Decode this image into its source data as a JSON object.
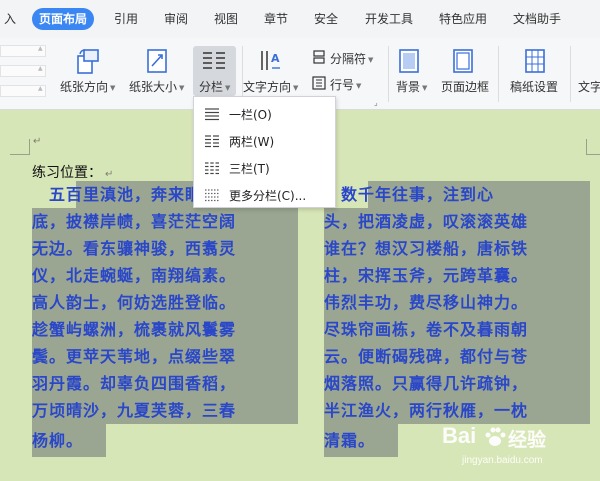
{
  "menubar": {
    "items": [
      {
        "label": "插入",
        "active": false
      },
      {
        "label": "页面布局",
        "active": true
      },
      {
        "label": "引用",
        "active": false
      },
      {
        "label": "审阅",
        "active": false
      },
      {
        "label": "视图",
        "active": false
      },
      {
        "label": "章节",
        "active": false
      },
      {
        "label": "安全",
        "active": false
      },
      {
        "label": "开发工具",
        "active": false
      },
      {
        "label": "特色应用",
        "active": false
      },
      {
        "label": "文档助手",
        "active": false
      }
    ],
    "truncated_first": "入"
  },
  "ribbon": {
    "orientation": "纸张方向",
    "size": "纸张大小",
    "columns": "分栏",
    "text_direction": "文字方向",
    "breaks": "分隔符",
    "line_numbers": "行号",
    "background": "背景",
    "page_border": "页面边框",
    "manuscript": "稿纸设置",
    "text_wrap_partial": "文字"
  },
  "dropdown": {
    "items": [
      {
        "label": "一栏(O)",
        "icon": "one-column-icon"
      },
      {
        "label": "两栏(W)",
        "icon": "two-columns-icon"
      },
      {
        "label": "三栏(T)",
        "icon": "three-columns-icon"
      },
      {
        "label": "更多分栏(C)...",
        "icon": "more-columns-icon"
      }
    ]
  },
  "document": {
    "label": "练习位置：",
    "paragraph_mark": "↵",
    "left_column": [
      "　五百里滇池，奔来眼",
      "底，披襟岸帻，喜茫茫空阔",
      "无边。看东骧神骏，西翥灵",
      "仪，北走蜿蜒，南翔缟素。",
      "高人韵士，何妨选胜登临。",
      "趁蟹屿螺洲，梳裹就风鬟雾",
      "鬓。更苹天苇地，点缀些翠",
      "羽丹霞。却辜负四围香稻，",
      "万顷晴沙，九夏芙蓉，三春",
      "杨柳。"
    ],
    "right_column": [
      "　数千年往事，注到心",
      "头，把酒凌虚，叹滚滚英雄",
      "谁在？想汉习楼船，唐标铁",
      "柱，宋挥玉斧，元跨革囊。",
      "伟烈丰功，费尽移山神力。",
      "尽珠帘画栋，卷不及暮雨朝",
      "云。便断碣残碑，都付与苍",
      "烟落照。只赢得几许疏钟，",
      "半江渔火，两行秋雁，一枕",
      "清霜。"
    ]
  },
  "watermark": {
    "brand": "Bai",
    "brand_suffix": "经验",
    "url": "jingyan.baidu.com"
  },
  "colors": {
    "active_tab": "#3a86f2",
    "page_bg": "#d7e6b7",
    "highlight": "#9aa691",
    "text": "#2a47c9"
  }
}
